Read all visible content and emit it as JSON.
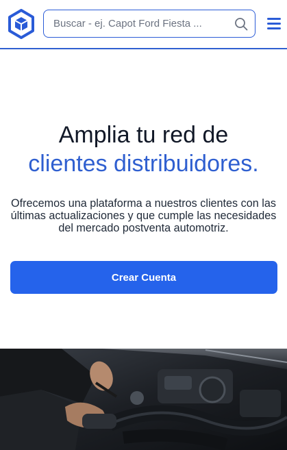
{
  "header": {
    "logo_icon": "cube-box-logo",
    "search": {
      "placeholder": "Buscar - ej. Capot Ford Fiesta ...",
      "value": ""
    },
    "search_icon": "search-icon",
    "menu_icon": "hamburger-menu-icon"
  },
  "hero": {
    "title_line1": "Amplia tu red de",
    "title_line2": "clientes distribuidores.",
    "description": "Ofrecemos una plataforma a nuestros clientes con las últimas actualizaciones y que cumple las necesidades del mercado postventa automotriz.",
    "cta_label": "Crear Cuenta"
  },
  "colors": {
    "brand": "#2a5bd7",
    "accent_text": "#2f5fd0",
    "cta": "#2563eb",
    "text": "#111827"
  }
}
